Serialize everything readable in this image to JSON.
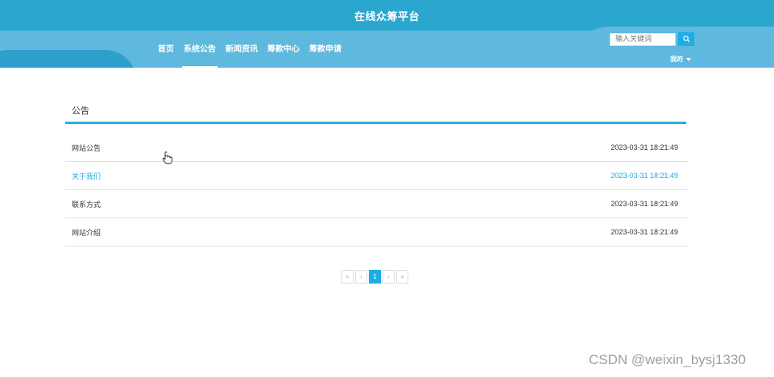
{
  "header": {
    "site_title": "在线众筹平台",
    "nav": [
      {
        "label": "首页"
      },
      {
        "label": "系统公告"
      },
      {
        "label": "新闻资讯"
      },
      {
        "label": "筹款中心"
      },
      {
        "label": "筹款申请"
      }
    ],
    "active_nav": "系统公告",
    "search_placeholder": "输入关键词",
    "user_menu_label": "我的"
  },
  "section": {
    "title": "公告"
  },
  "notices": [
    {
      "title": "网站公告",
      "date": "2023-03-31 18:21:49"
    },
    {
      "title": "关于我们",
      "date": "2023-03-31 18:21:49"
    },
    {
      "title": "联系方式",
      "date": "2023-03-31 18:21:49"
    },
    {
      "title": "网站介绍",
      "date": "2023-03-31 18:21:49"
    }
  ],
  "pagination": {
    "first": "«",
    "prev": "‹",
    "current": "1",
    "next": "›",
    "last": "»"
  },
  "watermark": "CSDN @weixin_bysj1330",
  "colors": {
    "header_bg": "#2ba6cf",
    "accent": "#22b2e6",
    "highlight_text": "#22a9dc"
  }
}
